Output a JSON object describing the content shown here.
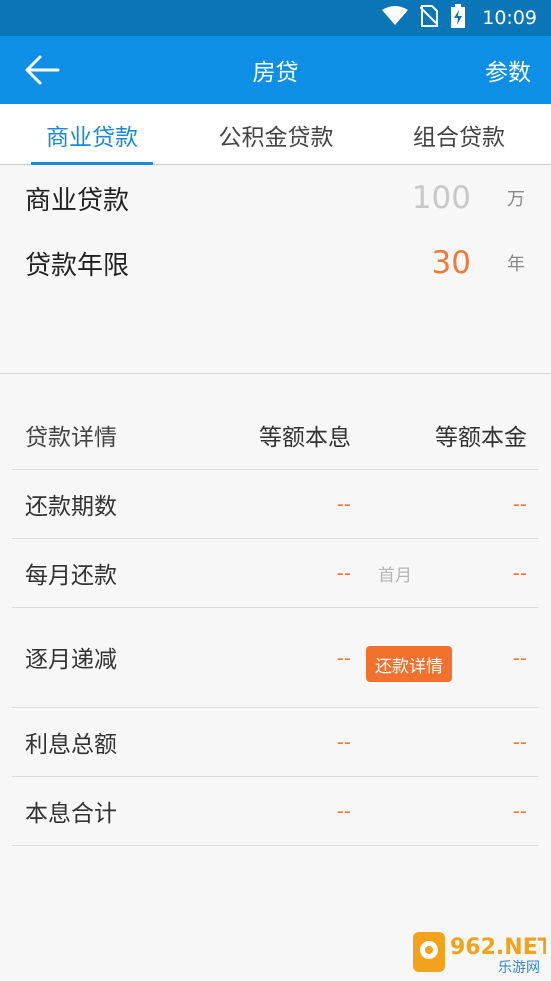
{
  "status_bar": {
    "time": "10:09"
  },
  "app_bar": {
    "title": "房贷",
    "right_action": "参数"
  },
  "tabs": [
    {
      "label": "商业贷款",
      "active": true
    },
    {
      "label": "公积金贷款",
      "active": false
    },
    {
      "label": "组合贷款",
      "active": false
    }
  ],
  "form": {
    "amount": {
      "label": "商业贷款",
      "placeholder": "100",
      "unit": "万"
    },
    "years": {
      "label": "贷款年限",
      "value": "30",
      "unit": "年"
    }
  },
  "table": {
    "header": {
      "label": "贷款详情",
      "col1": "等额本息",
      "col2": "等额本金"
    },
    "rows": [
      {
        "label": "还款期数",
        "col1": "--",
        "col2": "--"
      },
      {
        "label": "每月还款",
        "col1": "--",
        "note": "首月",
        "col2": "--"
      },
      {
        "label": "逐月递减",
        "col1": "--",
        "button": "还款详情",
        "col2": "--"
      },
      {
        "label": "利息总额",
        "col1": "--",
        "col2": "--"
      },
      {
        "label": "本息合计",
        "col1": "--",
        "col2": "--"
      }
    ]
  },
  "watermark": {
    "text": "962.NET",
    "subtext": "乐游网"
  },
  "colors": {
    "status_bar": "#0a76b8",
    "app_bar": "#0d8fe6",
    "accent": "#1a8ad8",
    "orange": "#f2712d",
    "value_orange": "#f07a3a",
    "placeholder": "#c8c8c8"
  },
  "icons": [
    "back-arrow-icon",
    "wifi-icon",
    "no-sim-icon",
    "battery-charging-icon"
  ]
}
